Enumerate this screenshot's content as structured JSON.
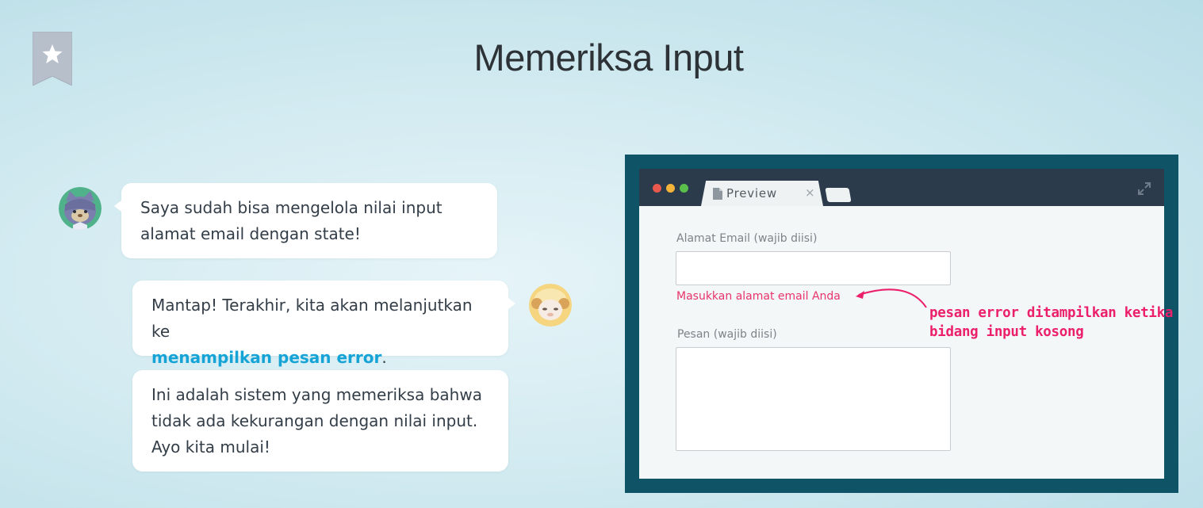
{
  "page": {
    "title": "Memeriksa Input"
  },
  "chat": {
    "messages": [
      {
        "speaker": "cat",
        "text": "Saya sudah bisa mengelola nilai input\nalamat email dengan state!"
      },
      {
        "speaker": "sheep",
        "text_before": "Mantap! Terakhir, kita akan melanjutkan ke",
        "highlight": "menampilkan pesan error",
        "text_after": "."
      },
      {
        "speaker": "sheep",
        "text": "Ini adalah sistem yang memeriksa bahwa\ntidak ada kekurangan dengan nilai input.\nAyo kita mulai!"
      }
    ]
  },
  "preview": {
    "tab_label": "Preview",
    "tab_close": "×",
    "email_label": "Alamat Email (wajib diisi)",
    "email_value": "",
    "email_error": "Masukkan alamat email Anda",
    "message_label": "Pesan (wajib diisi)",
    "message_value": "",
    "annotation": "pesan error ditampilkan ketika\nbidang input kosong"
  },
  "icons": {
    "bookmark": "bookmark-star-icon",
    "window_dots": [
      "close-dot-icon",
      "minimize-dot-icon",
      "maximize-dot-icon"
    ],
    "file": "file-icon",
    "expand": "expand-icon",
    "arrow": "curved-arrow-icon"
  },
  "colors": {
    "accent": "#16a3d6",
    "error": "#e8346b",
    "annotation": "#ec1f6b",
    "frame": "#0f5466",
    "browser_bar": "#2c3b4b",
    "dot_red": "#e8584c",
    "dot_yellow": "#f4b43a",
    "dot_green": "#5bbf4c"
  }
}
